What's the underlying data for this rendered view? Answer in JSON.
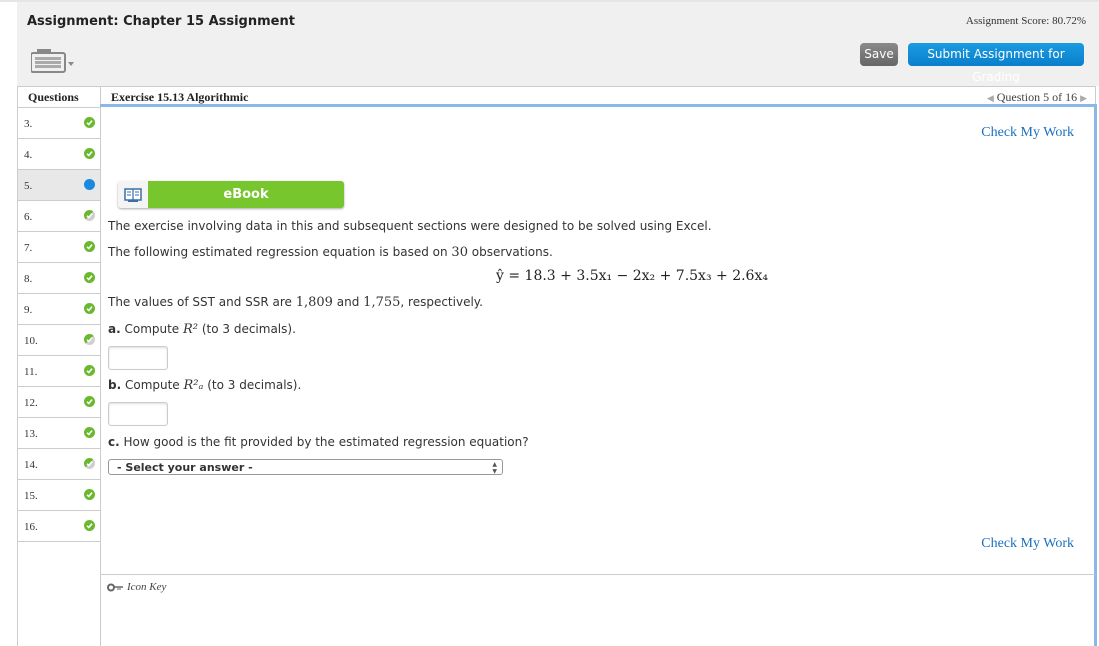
{
  "header": {
    "title": "Assignment: Chapter 15 Assignment",
    "score": "Assignment Score: 80.72%",
    "save_label": "Save",
    "submit_label": "Submit Assignment for Grading"
  },
  "sidebar": {
    "heading": "Questions",
    "items": [
      {
        "label": "3.",
        "status": "correct"
      },
      {
        "label": "4.",
        "status": "correct"
      },
      {
        "label": "5.",
        "status": "current"
      },
      {
        "label": "6.",
        "status": "partial"
      },
      {
        "label": "7.",
        "status": "correct"
      },
      {
        "label": "8.",
        "status": "correct"
      },
      {
        "label": "9.",
        "status": "correct"
      },
      {
        "label": "10.",
        "status": "partial"
      },
      {
        "label": "11.",
        "status": "correct"
      },
      {
        "label": "12.",
        "status": "correct"
      },
      {
        "label": "13.",
        "status": "correct"
      },
      {
        "label": "14.",
        "status": "partial"
      },
      {
        "label": "15.",
        "status": "correct"
      },
      {
        "label": "16.",
        "status": "correct"
      }
    ]
  },
  "main": {
    "exercise_title": "Exercise 15.13 Algorithmic",
    "question_nav": "Question 5 of 16",
    "check_my_work": "Check My Work",
    "ebook_label": "eBook",
    "intro": "The exercise involving data in this and subsequent sections were designed to be solved using Excel.",
    "equation_intro_pre": "The following estimated regression equation is based on ",
    "observations": "30",
    "equation_intro_post": " observations.",
    "equation": "ŷ = 18.3 + 3.5x₁ − 2x₂ + 7.5x₃ + 2.6x₄",
    "sst_pre": "The values of SST and SSR are ",
    "sst": "1,809",
    "sst_mid": " and ",
    "ssr": "1,755",
    "sst_post": ", respectively.",
    "part_a_label": "a.",
    "part_a_text": " Compute ",
    "part_a_symbol": "R²",
    "part_a_suffix": " (to 3 decimals).",
    "part_a_value": "",
    "part_b_label": "b.",
    "part_b_text": " Compute ",
    "part_b_symbol": "R²ₐ",
    "part_b_suffix": " (to 3 decimals).",
    "part_b_value": "",
    "part_c_label": "c.",
    "part_c_text": " How good is the fit provided by the estimated regression equation?",
    "select_value": "- Select your answer -",
    "icon_key": "Icon Key"
  }
}
